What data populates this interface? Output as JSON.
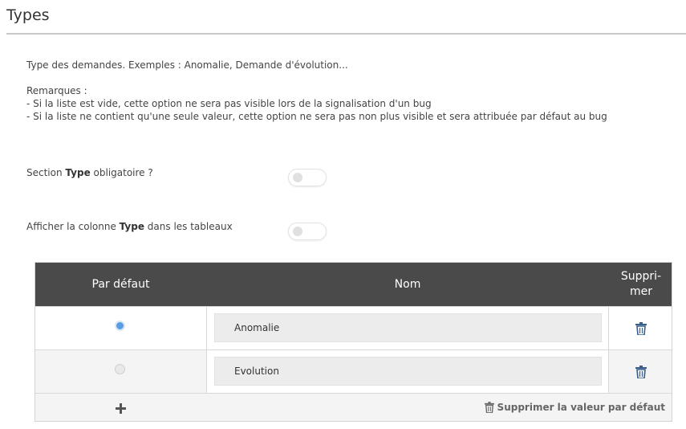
{
  "page": {
    "title": "Types"
  },
  "description": {
    "line1": "Type des demandes. Exemples : Anomalie, Demande d'évolution...",
    "remarks_title": "Remarques :",
    "remark1": "- Si la liste est vide, cette option ne sera pas visible lors de la signalisation d'un bug",
    "remark2": "- Si la liste ne contient qu'une seule valeur, cette option ne sera pas non plus visible et sera attribuée par défaut au bug"
  },
  "settings": {
    "mandatory": {
      "prefix": "Section ",
      "bold": "Type",
      "suffix": " obligatoire ?",
      "enabled": false
    },
    "show_column": {
      "prefix": "Afficher la colonne ",
      "bold": "Type",
      "suffix": " dans les tableaux",
      "enabled": false
    }
  },
  "table": {
    "headers": {
      "default": "Par défaut",
      "name": "Nom",
      "delete_line1": "Suppri-",
      "delete_line2": "mer"
    },
    "rows": [
      {
        "name": "Anomalie",
        "is_default": true,
        "icon": "trash-icon"
      },
      {
        "name": "Evolution",
        "is_default": false,
        "icon": "trash-icon"
      }
    ],
    "footer": {
      "add_icon": "plus-icon",
      "remove_default_label": "Supprimer la valeur par défaut",
      "remove_default_icon": "trash-icon"
    }
  },
  "colors": {
    "header_bg": "#4a4a4a",
    "radio_selected": "#5b9de2",
    "trash": "#3a5f8a"
  }
}
